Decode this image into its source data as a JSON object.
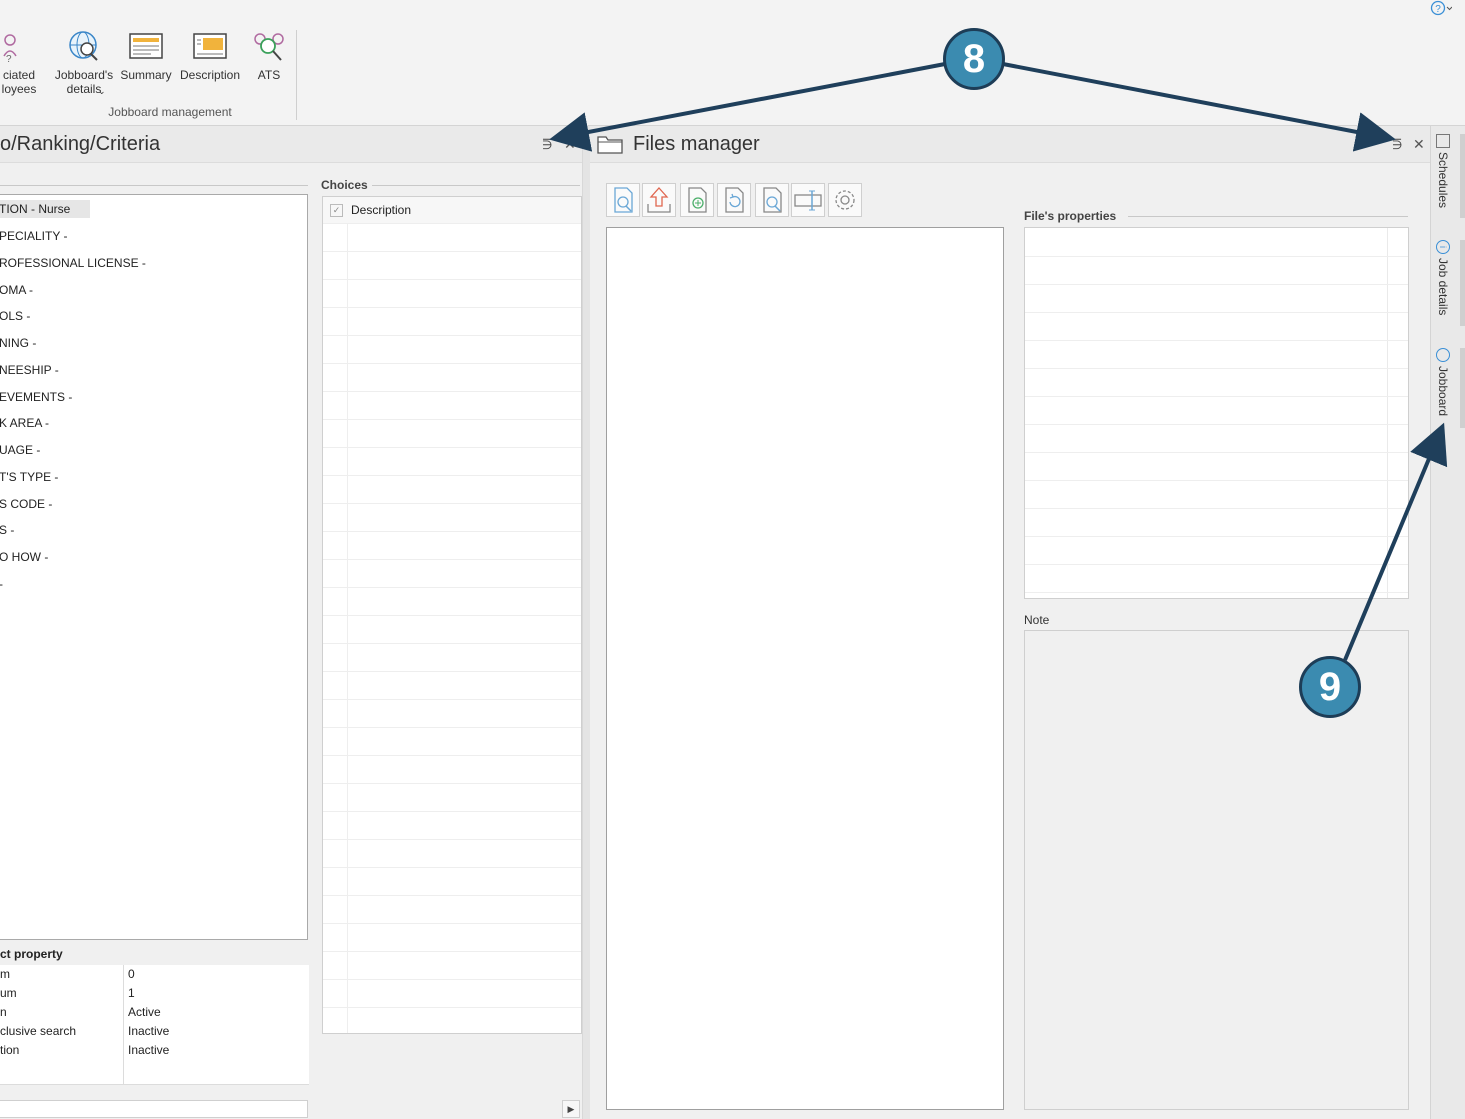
{
  "ribbon": {
    "buttons": [
      {
        "label": "ciated\nloyees",
        "icon": "associated-employees-icon"
      },
      {
        "label": "Jobboard's\ndetails",
        "icon": "jobboard-details-icon"
      },
      {
        "label": "Summary",
        "icon": "summary-icon"
      },
      {
        "label": "Description",
        "icon": "description-icon"
      },
      {
        "label": "ATS",
        "icon": "ats-icon"
      }
    ],
    "group_label": "Jobboard management",
    "help_icon": "help-icon"
  },
  "left_panel": {
    "title": "o/Ranking/Criteria",
    "criteria": [
      "TION - Nurse",
      "PECIALITY -",
      "ROFESSIONAL LICENSE -",
      "OMA -",
      "OLS -",
      "NING -",
      "NEESHIP -",
      "EVEMENTS -",
      "K AREA -",
      "UAGE -",
      "T'S TYPE -",
      "S CODE -",
      "S -",
      "O HOW -",
      "-"
    ],
    "choices_label": "Choices",
    "choices_header": "Description",
    "property_title": "ct property",
    "properties": [
      {
        "name": "m",
        "value": "0"
      },
      {
        "name": "um",
        "value": "1"
      },
      {
        "name": "n",
        "value": "Active"
      },
      {
        "name": "clusive search",
        "value": "Inactive"
      },
      {
        "name": "tion",
        "value": "Inactive"
      },
      {
        "name": "",
        "value": ""
      }
    ]
  },
  "right_panel": {
    "title": "Files manager",
    "toolbar_icons": [
      "preview-icon",
      "upload-icon",
      "add-file-icon",
      "refresh-file-icon",
      "search-file-icon",
      "rename-icon",
      "settings-icon"
    ],
    "file_properties_label": "File's properties",
    "note_label": "Note"
  },
  "side_tabs": [
    "Schedules",
    "Job details",
    "Jobboard"
  ],
  "callouts": [
    "8",
    "9"
  ],
  "colors": {
    "callout_fill": "#3b8bb0",
    "callout_stroke": "#1d3d57",
    "arrow": "#1f3f5b"
  }
}
